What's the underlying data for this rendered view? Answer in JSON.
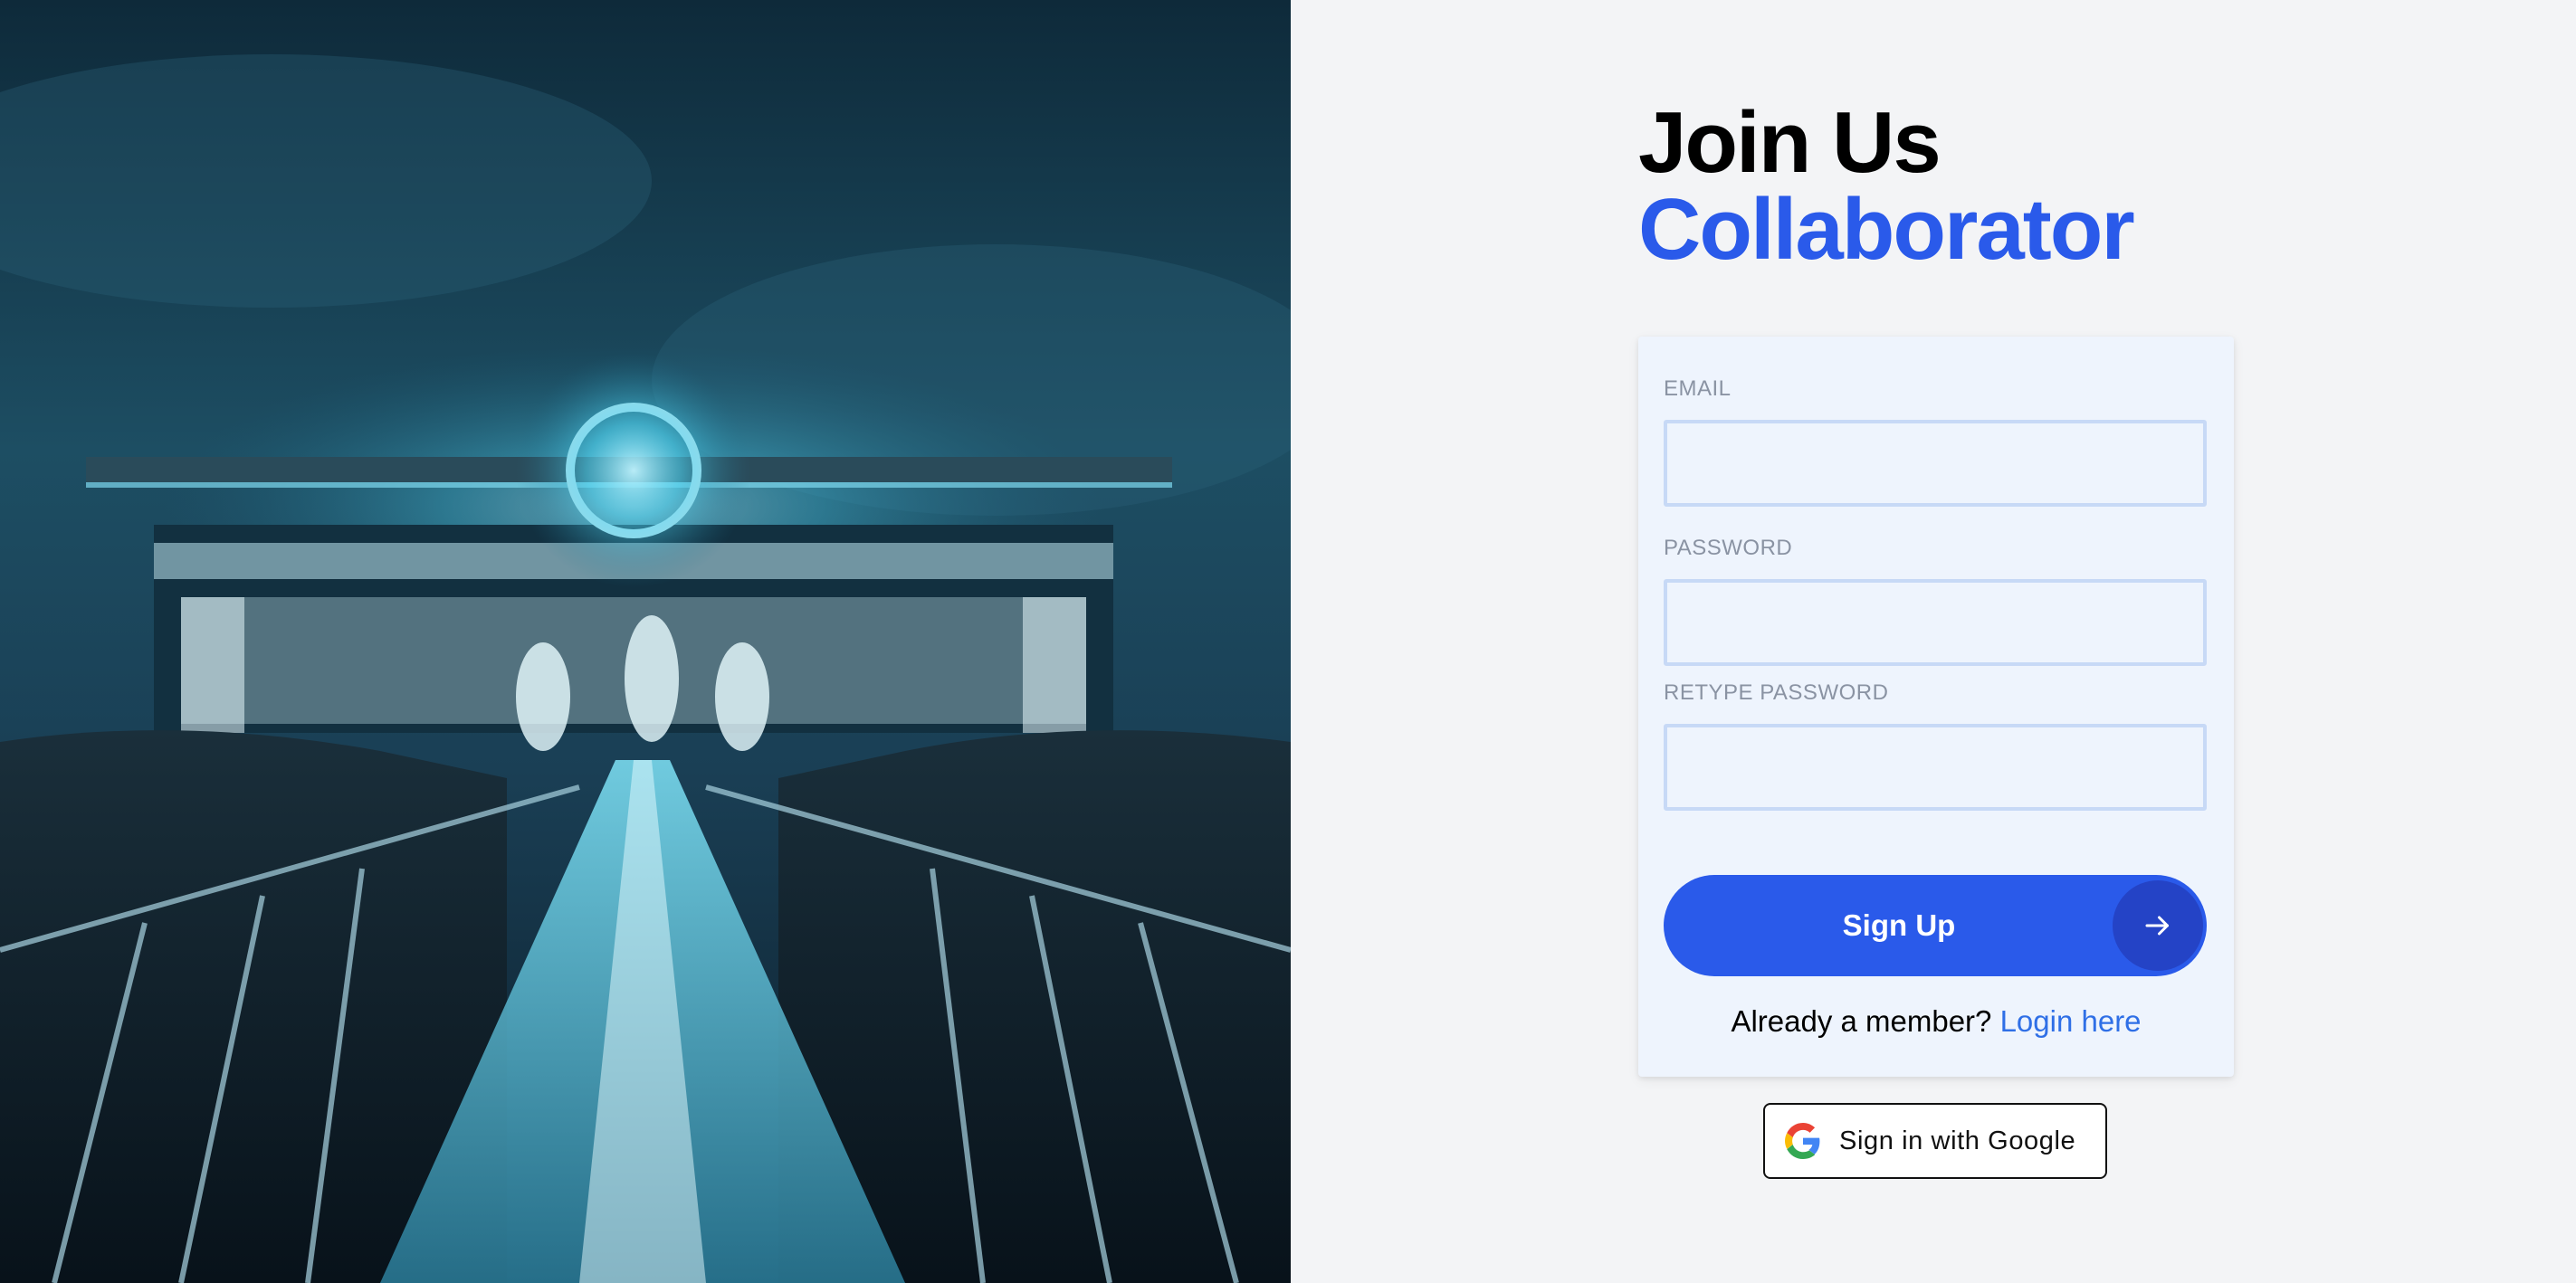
{
  "hero": {
    "image": "concert-stage-photo"
  },
  "heading": {
    "line1": "Join Us",
    "line2": "Collaborator"
  },
  "form": {
    "email_label": "EMAIL",
    "email_value": "",
    "password_label": "PASSWORD",
    "password_value": "",
    "retype_label": "RETYPE PASSWORD",
    "retype_value": "",
    "signup_label": "Sign Up",
    "signup_icon": "arrow-right-icon",
    "member_text": "Already a member? ",
    "login_link": "Login here"
  },
  "google": {
    "label": "Sign in with Google",
    "icon": "google-icon"
  },
  "colors": {
    "accent": "#2a5aea",
    "accent_dark": "#2443c6",
    "link": "#2f6fe6",
    "card_bg": "#eef4fd",
    "page_bg": "#f3f4f6"
  }
}
